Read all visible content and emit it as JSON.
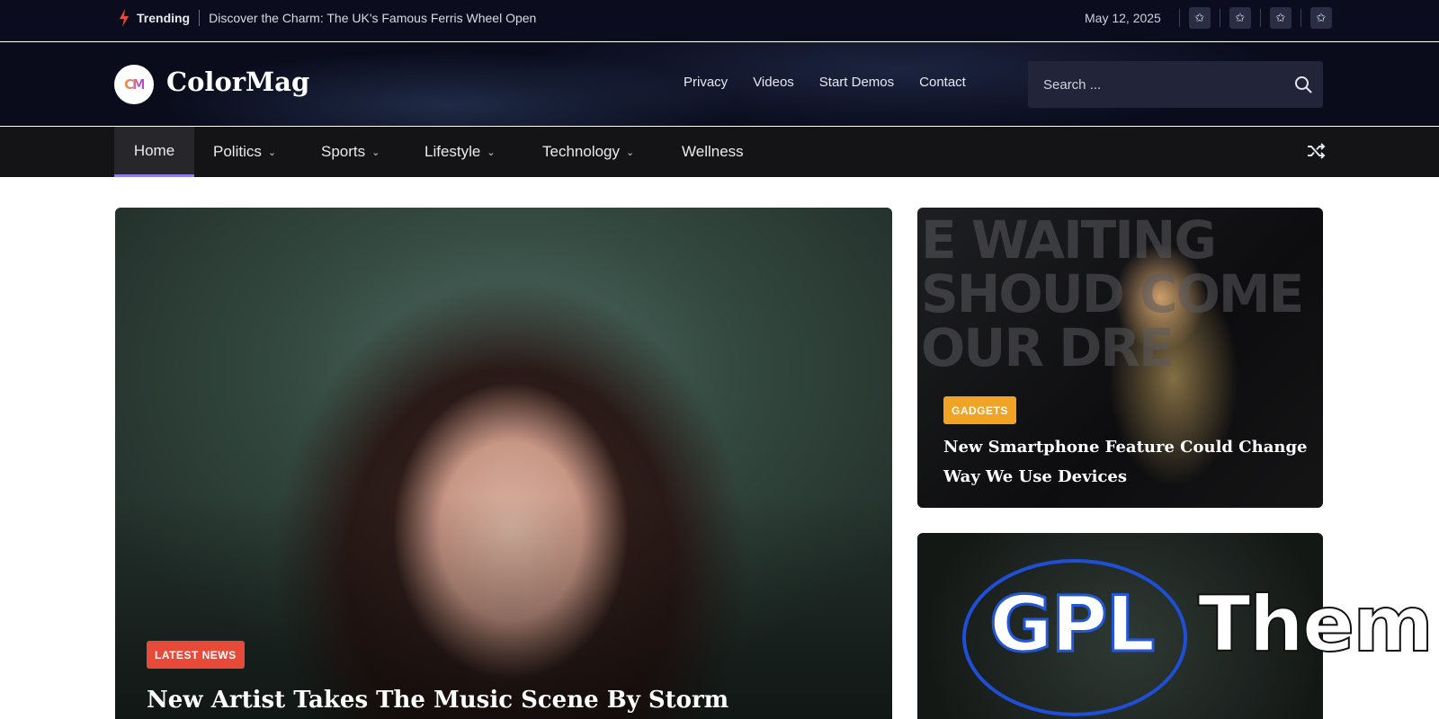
{
  "topbar": {
    "trending_label": "Trending",
    "trending_headline": "Discover the Charm: The UK's Famous Ferris Wheel Open",
    "date": "May 12, 2025",
    "social_icons": [
      "star-icon",
      "star-icon",
      "star-icon",
      "star-icon"
    ],
    "social_glyph": "✩"
  },
  "header": {
    "logo_mark": "CM",
    "site_name": "ColorMag",
    "nav": [
      "Privacy",
      "Videos",
      "Start Demos",
      "Contact"
    ],
    "search_placeholder": "Search ..."
  },
  "mainnav": {
    "items": [
      {
        "label": "Home",
        "active": true
      },
      {
        "label": "Politics",
        "dropdown": true
      },
      {
        "label": "Sports",
        "dropdown": true
      },
      {
        "label": "Lifestyle",
        "dropdown": true
      },
      {
        "label": "Technology",
        "dropdown": true
      },
      {
        "label": "Wellness"
      }
    ],
    "chevron": "⌄"
  },
  "featured": {
    "badge": "LATEST NEWS",
    "title": "New Artist Takes The Music Scene By Storm"
  },
  "side_posts": [
    {
      "badge": "GADGETS",
      "title": "New Smartphone Feature Could Change Way We Use Devices",
      "image_text": "E WAITING\nSHOUD COME\nOUR DRE\nLIT\nCA"
    }
  ],
  "watermark": {
    "left": "GPL",
    "right": "Them"
  },
  "colors": {
    "topbar_bg": "#0b0d1e",
    "nav_bg": "#141416",
    "active_underline": "#8b7cf0",
    "badge_red": "#e84a3a",
    "badge_yellow": "#f0a325",
    "watermark_blue": "#1e4fd6"
  }
}
